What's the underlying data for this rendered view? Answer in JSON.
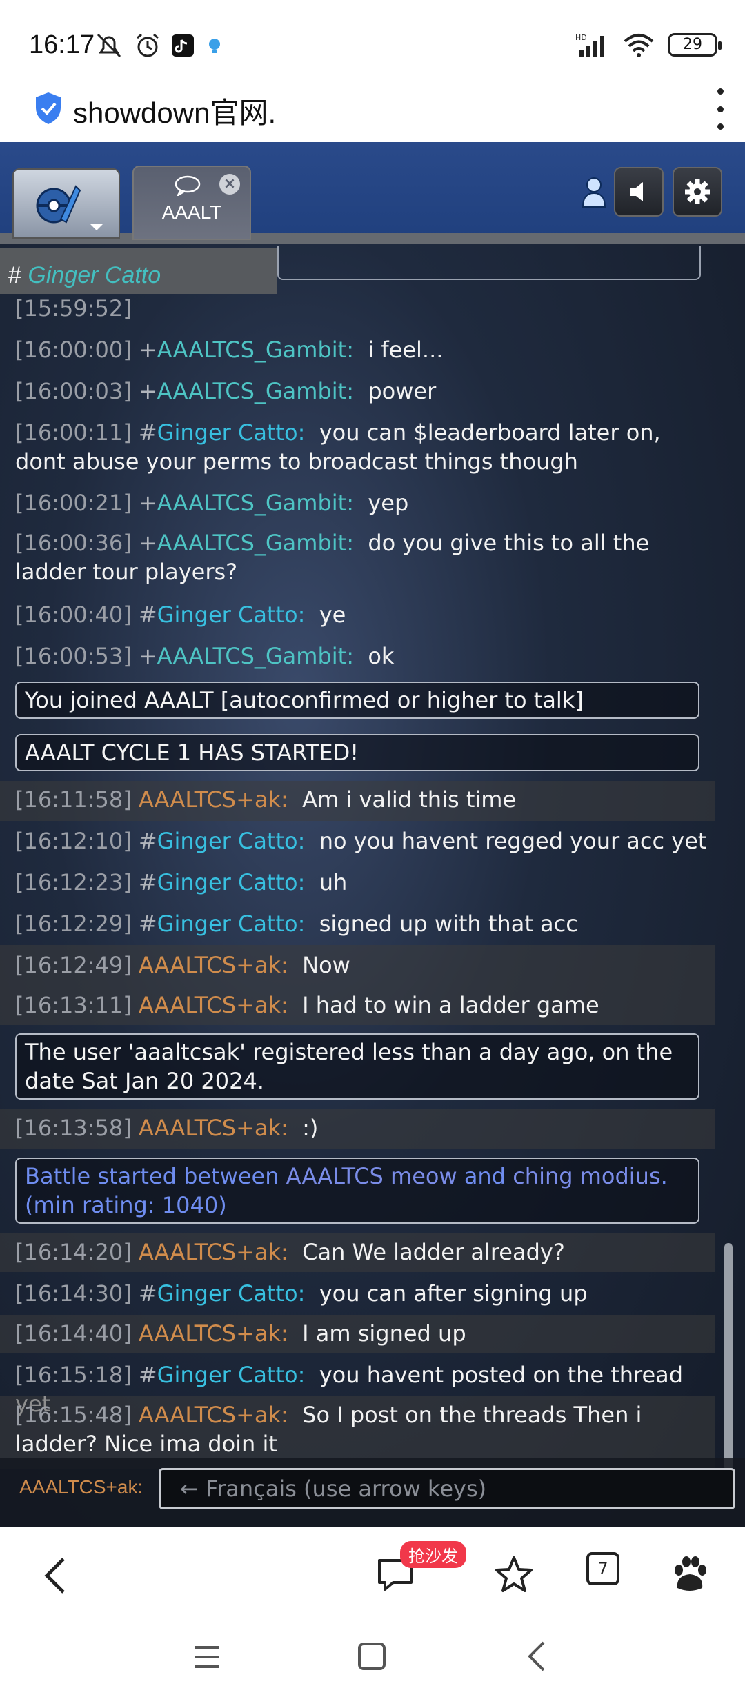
{
  "status_bar": {
    "time": "16:17",
    "battery": "29"
  },
  "browser": {
    "url": "showdown官网."
  },
  "room": {
    "tab_label": "AAALT",
    "title_prefix": "#",
    "title_name": "Ginger Catto"
  },
  "chat": {
    "lines": [
      {
        "ts": "[15:59:52]",
        "sym": "",
        "name": "",
        "msg": ""
      },
      {
        "ts": "[16:00:00]",
        "sym": "+",
        "name": "AAALTCS_Gambit:",
        "msg": "i feel..."
      },
      {
        "ts": "[16:00:03]",
        "sym": "+",
        "name": "AAALTCS_Gambit:",
        "msg": "power"
      },
      {
        "ts": "[16:00:11]",
        "sym": "#",
        "name": "Ginger Catto:",
        "msg": "you can $leaderboard later on, dont abuse your perms to broadcast things though"
      },
      {
        "ts": "[16:00:21]",
        "sym": "+",
        "name": "AAALTCS_Gambit:",
        "msg": "yep"
      },
      {
        "ts": "[16:00:36]",
        "sym": "+",
        "name": "AAALTCS_Gambit:",
        "msg": "do you give this to all the ladder tour players?"
      },
      {
        "ts": "[16:00:40]",
        "sym": "#",
        "name": "Ginger Catto:",
        "msg": "ye"
      },
      {
        "ts": "[16:00:53]",
        "sym": "+",
        "name": "AAALTCS_Gambit:",
        "msg": "ok"
      }
    ],
    "notice_joined": "You joined AAALT [autoconfirmed or higher to talk]",
    "notice_started": "AAALT CYCLE 1 HAS STARTED!",
    "lines2": [
      {
        "ts": "[16:11:58]",
        "sym": "",
        "name": "AAALTCS+ak:",
        "msg": "Am i valid this time"
      },
      {
        "ts": "[16:12:10]",
        "sym": "#",
        "name": "Ginger Catto:",
        "msg": "no you havent regged your acc yet"
      },
      {
        "ts": "[16:12:23]",
        "sym": "#",
        "name": "Ginger Catto:",
        "msg": "uh"
      },
      {
        "ts": "[16:12:29]",
        "sym": "#",
        "name": "Ginger Catto:",
        "msg": "signed up with that acc"
      },
      {
        "ts": "[16:12:49]",
        "sym": "",
        "name": "AAALTCS+ak:",
        "msg": "Now"
      },
      {
        "ts": "[16:13:11]",
        "sym": "",
        "name": "AAALTCS+ak:",
        "msg": "I had to win a ladder game"
      }
    ],
    "notice_registered": "The user 'aaaltcsak' registered less than a day ago, on the date Sat Jan 20 2024.",
    "line_smile": {
      "ts": "[16:13:58]",
      "sym": "",
      "name": "AAALTCS+ak:",
      "msg": ":)"
    },
    "battle_prefix": "Battle started between ",
    "battle_p1": "AAALTCS meow",
    "battle_and": " and ",
    "battle_p2": "ching modius",
    "battle_suffix": ".",
    "battle_rating": "(min rating: 1040)",
    "lines3": [
      {
        "ts": "[16:14:20]",
        "sym": "",
        "name": "AAALTCS+ak:",
        "msg": "Can We ladder already?"
      },
      {
        "ts": "[16:14:30]",
        "sym": "#",
        "name": "Ginger Catto:",
        "msg": "you can after signing up"
      },
      {
        "ts": "[16:14:40]",
        "sym": "",
        "name": "AAALTCS+ak:",
        "msg": "I am signed up"
      },
      {
        "ts": "[16:15:18]",
        "sym": "#",
        "name": "Ginger Catto:",
        "msg": "you havent posted on the thread yet"
      },
      {
        "ts": "[16:15:48]",
        "sym": "",
        "name": "AAALTCS+ak:",
        "msg": "So I post on the threads Then i ladder? Nice ima doin it"
      }
    ]
  },
  "input": {
    "user_label": "AAALTCS+ak:",
    "placeholder": "← Français (use arrow keys)"
  },
  "bottom_nav": {
    "badge": "抢沙发",
    "tabs_count": "7"
  }
}
